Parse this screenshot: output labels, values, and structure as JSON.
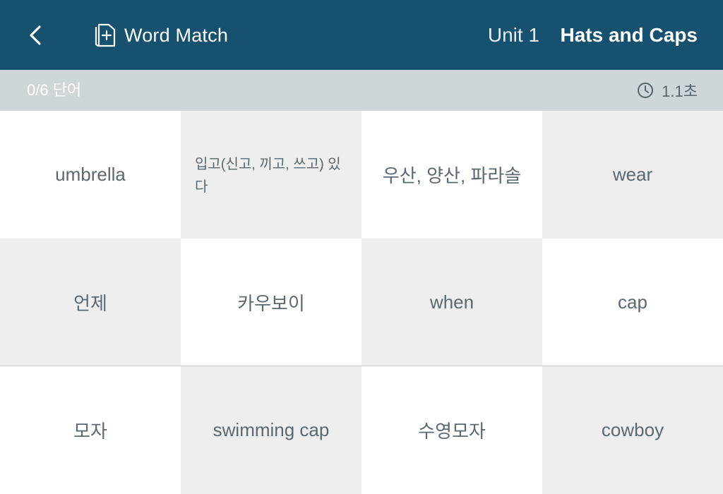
{
  "header": {
    "mode_label": "Word Match",
    "unit_label": "Unit 1",
    "set_title": "Hats and Caps"
  },
  "status": {
    "progress": "0/6 단어",
    "timer": "1.1초"
  },
  "cards": [
    {
      "text": "umbrella",
      "style": "light"
    },
    {
      "text": "입고(신고, 끼고, 쓰고) 있다",
      "style": "dark"
    },
    {
      "text": "우산, 양산, 파라솔",
      "style": "light"
    },
    {
      "text": "wear",
      "style": "dark"
    },
    {
      "text": "언제",
      "style": "dark"
    },
    {
      "text": "카우보이",
      "style": "light"
    },
    {
      "text": "when",
      "style": "dark"
    },
    {
      "text": "cap",
      "style": "light"
    },
    {
      "text": "모자",
      "style": "light"
    },
    {
      "text": "swimming cap",
      "style": "dark"
    },
    {
      "text": "수영모자",
      "style": "light"
    },
    {
      "text": "cowboy",
      "style": "dark"
    }
  ],
  "colors": {
    "header_bg": "#165170",
    "status_bg": "#cfd6da",
    "card_light": "#ffffff",
    "card_dark": "#eeeeee"
  },
  "icons": {
    "back": "chevron-left-icon",
    "mode": "cards-plus-icon",
    "timer": "clock-icon"
  }
}
